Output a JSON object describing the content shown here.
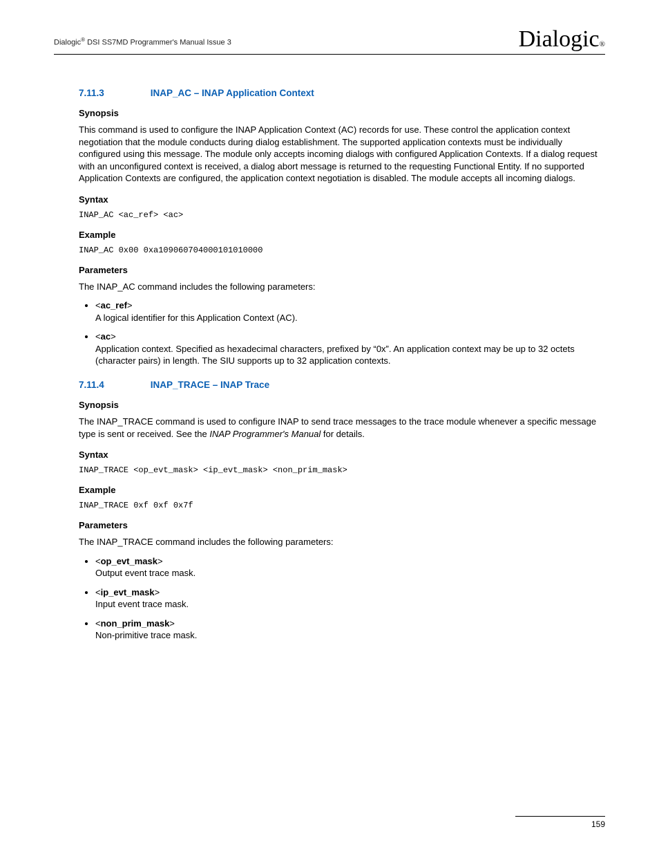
{
  "header": {
    "left_prefix": "Dialogic",
    "left_suffix": " DSI SS7MD Programmer's Manual  Issue 3",
    "logo_text": "Dialogic",
    "logo_reg": "®"
  },
  "sections": [
    {
      "number": "7.11.3",
      "title": "INAP_AC – INAP Application Context",
      "synopsis_label": "Synopsis",
      "synopsis_text": "This command is used to configure the INAP Application Context (AC) records for use. These control the application context negotiation that the module conducts during dialog establishment. The supported application contexts must be individually configured using this message. The module only accepts incoming dialogs with configured Application Contexts. If a dialog request with an unconfigured context is received, a dialog abort message is returned to the requesting Functional Entity. If no supported Application Contexts are configured, the application context negotiation is disabled. The module accepts all incoming dialogs.",
      "syntax_label": "Syntax",
      "syntax_code": "INAP_AC <ac_ref> <ac>",
      "example_label": "Example",
      "example_code": "INAP_AC 0x00 0xa109060704000101010000",
      "parameters_label": "Parameters",
      "parameters_intro": "The INAP_AC command includes the following parameters:",
      "parameters": [
        {
          "name": "<ac_ref>",
          "desc": "A logical identifier for this Application Context (AC)."
        },
        {
          "name": "<ac>",
          "desc": "Application context. Specified as hexadecimal characters, prefixed by “0x”. An application context may be up to 32 octets (character pairs) in length. The SIU supports up to 32 application contexts."
        }
      ]
    },
    {
      "number": "7.11.4",
      "title": "INAP_TRACE – INAP Trace",
      "synopsis_label": "Synopsis",
      "synopsis_text_pre": "The INAP_TRACE command is used to configure INAP to send trace messages to the trace module whenever a specific message type is sent or received. See the ",
      "synopsis_text_italic": "INAP Programmer's Manual",
      "synopsis_text_post": " for details.",
      "syntax_label": "Syntax",
      "syntax_code": "INAP_TRACE <op_evt_mask> <ip_evt_mask> <non_prim_mask>",
      "example_label": "Example",
      "example_code": "INAP_TRACE 0xf 0xf 0x7f",
      "parameters_label": "Parameters",
      "parameters_intro": "The INAP_TRACE command includes the following parameters:",
      "parameters": [
        {
          "name": "<op_evt_mask>",
          "desc": "Output event trace mask."
        },
        {
          "name": "<ip_evt_mask>",
          "desc": "Input event trace mask."
        },
        {
          "name": "<non_prim_mask>",
          "desc": "Non-primitive trace mask."
        }
      ]
    }
  ],
  "page_number": "159"
}
